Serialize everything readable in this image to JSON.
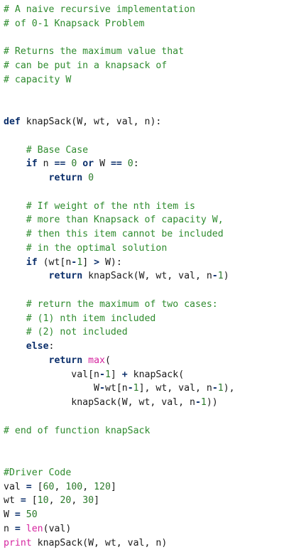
{
  "colors": {
    "background": "#ffffff",
    "comment": "#2e8b2e",
    "keyword": "#0b2f6b",
    "number": "#2a7a2a",
    "builtin": "#d6249f",
    "plain": "#1a1a1a"
  },
  "code": {
    "lines": [
      [
        {
          "t": "comment",
          "v": "# A naive recursive implementation"
        }
      ],
      [
        {
          "t": "comment",
          "v": "# of 0-1 Knapsack Problem"
        }
      ],
      [],
      [
        {
          "t": "comment",
          "v": "# Returns the maximum value that"
        }
      ],
      [
        {
          "t": "comment",
          "v": "# can be put in a knapsack of"
        }
      ],
      [
        {
          "t": "comment",
          "v": "# capacity W"
        }
      ],
      [],
      [],
      [
        {
          "t": "keyword",
          "v": "def"
        },
        {
          "t": "plain",
          "v": " knapSack(W, wt, val, n):"
        }
      ],
      [],
      [
        {
          "t": "plain",
          "v": "    "
        },
        {
          "t": "comment",
          "v": "# Base Case"
        }
      ],
      [
        {
          "t": "plain",
          "v": "    "
        },
        {
          "t": "keyword",
          "v": "if"
        },
        {
          "t": "plain",
          "v": " n "
        },
        {
          "t": "operator",
          "v": "=="
        },
        {
          "t": "plain",
          "v": " "
        },
        {
          "t": "number",
          "v": "0"
        },
        {
          "t": "plain",
          "v": " "
        },
        {
          "t": "keyword",
          "v": "or"
        },
        {
          "t": "plain",
          "v": " W "
        },
        {
          "t": "operator",
          "v": "=="
        },
        {
          "t": "plain",
          "v": " "
        },
        {
          "t": "number",
          "v": "0"
        },
        {
          "t": "plain",
          "v": ":"
        }
      ],
      [
        {
          "t": "plain",
          "v": "        "
        },
        {
          "t": "keyword",
          "v": "return"
        },
        {
          "t": "plain",
          "v": " "
        },
        {
          "t": "number",
          "v": "0"
        }
      ],
      [],
      [
        {
          "t": "plain",
          "v": "    "
        },
        {
          "t": "comment",
          "v": "# If weight of the nth item is"
        }
      ],
      [
        {
          "t": "plain",
          "v": "    "
        },
        {
          "t": "comment",
          "v": "# more than Knapsack of capacity W,"
        }
      ],
      [
        {
          "t": "plain",
          "v": "    "
        },
        {
          "t": "comment",
          "v": "# then this item cannot be included"
        }
      ],
      [
        {
          "t": "plain",
          "v": "    "
        },
        {
          "t": "comment",
          "v": "# in the optimal solution"
        }
      ],
      [
        {
          "t": "plain",
          "v": "    "
        },
        {
          "t": "keyword",
          "v": "if"
        },
        {
          "t": "plain",
          "v": " (wt[n"
        },
        {
          "t": "operator",
          "v": "-"
        },
        {
          "t": "number",
          "v": "1"
        },
        {
          "t": "plain",
          "v": "] "
        },
        {
          "t": "operator",
          "v": ">"
        },
        {
          "t": "plain",
          "v": " W):"
        }
      ],
      [
        {
          "t": "plain",
          "v": "        "
        },
        {
          "t": "keyword",
          "v": "return"
        },
        {
          "t": "plain",
          "v": " knapSack(W, wt, val, n"
        },
        {
          "t": "operator",
          "v": "-"
        },
        {
          "t": "number",
          "v": "1"
        },
        {
          "t": "plain",
          "v": ")"
        }
      ],
      [],
      [
        {
          "t": "plain",
          "v": "    "
        },
        {
          "t": "comment",
          "v": "# return the maximum of two cases:"
        }
      ],
      [
        {
          "t": "plain",
          "v": "    "
        },
        {
          "t": "comment",
          "v": "# (1) nth item included"
        }
      ],
      [
        {
          "t": "plain",
          "v": "    "
        },
        {
          "t": "comment",
          "v": "# (2) not included"
        }
      ],
      [
        {
          "t": "plain",
          "v": "    "
        },
        {
          "t": "keyword",
          "v": "else"
        },
        {
          "t": "plain",
          "v": ":"
        }
      ],
      [
        {
          "t": "plain",
          "v": "        "
        },
        {
          "t": "keyword",
          "v": "return"
        },
        {
          "t": "plain",
          "v": " "
        },
        {
          "t": "builtin",
          "v": "max"
        },
        {
          "t": "plain",
          "v": "("
        }
      ],
      [
        {
          "t": "plain",
          "v": "            val[n"
        },
        {
          "t": "operator",
          "v": "-"
        },
        {
          "t": "number",
          "v": "1"
        },
        {
          "t": "plain",
          "v": "] "
        },
        {
          "t": "operator",
          "v": "+"
        },
        {
          "t": "plain",
          "v": " knapSack("
        }
      ],
      [
        {
          "t": "plain",
          "v": "                W"
        },
        {
          "t": "operator",
          "v": "-"
        },
        {
          "t": "plain",
          "v": "wt[n"
        },
        {
          "t": "operator",
          "v": "-"
        },
        {
          "t": "number",
          "v": "1"
        },
        {
          "t": "plain",
          "v": "], wt, val, n"
        },
        {
          "t": "operator",
          "v": "-"
        },
        {
          "t": "number",
          "v": "1"
        },
        {
          "t": "plain",
          "v": "),"
        }
      ],
      [
        {
          "t": "plain",
          "v": "            knapSack(W, wt, val, n"
        },
        {
          "t": "operator",
          "v": "-"
        },
        {
          "t": "number",
          "v": "1"
        },
        {
          "t": "plain",
          "v": "))"
        }
      ],
      [],
      [
        {
          "t": "comment",
          "v": "# end of function knapSack"
        }
      ],
      [],
      [],
      [
        {
          "t": "comment",
          "v": "#Driver Code"
        }
      ],
      [
        {
          "t": "plain",
          "v": "val "
        },
        {
          "t": "operator",
          "v": "="
        },
        {
          "t": "plain",
          "v": " ["
        },
        {
          "t": "number",
          "v": "60"
        },
        {
          "t": "plain",
          "v": ", "
        },
        {
          "t": "number",
          "v": "100"
        },
        {
          "t": "plain",
          "v": ", "
        },
        {
          "t": "number",
          "v": "120"
        },
        {
          "t": "plain",
          "v": "]"
        }
      ],
      [
        {
          "t": "plain",
          "v": "wt "
        },
        {
          "t": "operator",
          "v": "="
        },
        {
          "t": "plain",
          "v": " ["
        },
        {
          "t": "number",
          "v": "10"
        },
        {
          "t": "plain",
          "v": ", "
        },
        {
          "t": "number",
          "v": "20"
        },
        {
          "t": "plain",
          "v": ", "
        },
        {
          "t": "number",
          "v": "30"
        },
        {
          "t": "plain",
          "v": "]"
        }
      ],
      [
        {
          "t": "plain",
          "v": "W "
        },
        {
          "t": "operator",
          "v": "="
        },
        {
          "t": "plain",
          "v": " "
        },
        {
          "t": "number",
          "v": "50"
        }
      ],
      [
        {
          "t": "plain",
          "v": "n "
        },
        {
          "t": "operator",
          "v": "="
        },
        {
          "t": "plain",
          "v": " "
        },
        {
          "t": "builtin",
          "v": "len"
        },
        {
          "t": "plain",
          "v": "(val)"
        }
      ],
      [
        {
          "t": "builtin",
          "v": "print"
        },
        {
          "t": "plain",
          "v": " knapSack(W, wt, val, n)"
        }
      ]
    ]
  }
}
